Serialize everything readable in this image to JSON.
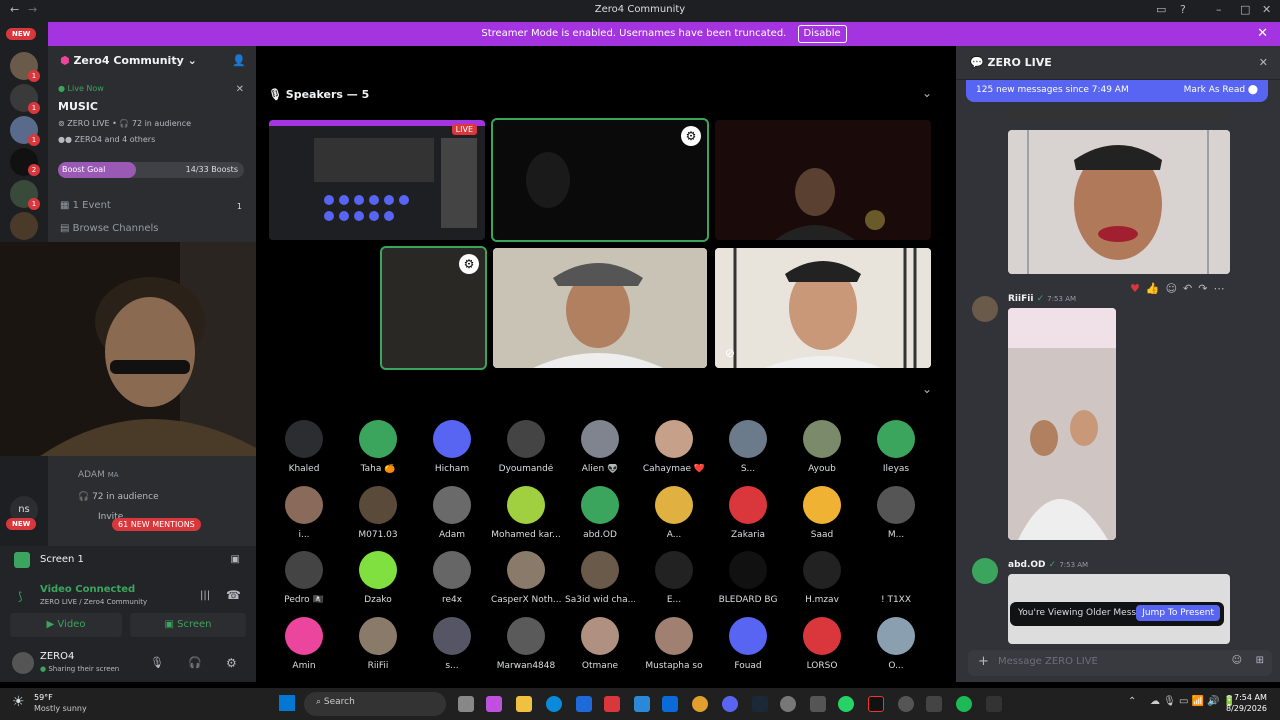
{
  "window": {
    "title": "Zero4 Community"
  },
  "banner": {
    "text": "Streamer Mode is enabled. Usernames have been truncated.",
    "disable": "Disable"
  },
  "rail": {
    "new_top": "NEW",
    "new_bottom": "NEW",
    "badges": [
      "1",
      "1",
      "1",
      "1",
      "2",
      "1",
      "1"
    ],
    "ns": "ns"
  },
  "sidebar": {
    "server_name": "Zero4 Community",
    "live_now": "Live Now",
    "channel": "MUSIC",
    "stage_info": "ZERO LIVE",
    "audience": "72 in audience",
    "participants": "ZERO4 and 4 others",
    "boost_label": "Boost Goal",
    "boost_count": "14/33 Boosts",
    "event": "1 Event",
    "event_count": "1",
    "browse": "Browse Channels",
    "member_adam": "ADAM",
    "adam_tag": "MA",
    "audience2": "72 in audience",
    "invite": "Invite...",
    "mentions": "61 NEW MENTIONS"
  },
  "voice": {
    "screen_label": "Screen 1",
    "status": "Video Connected",
    "location": "ZERO LIVE / Zero4 Community",
    "video_btn": "Video",
    "screen_btn": "Screen",
    "user": "ZERO4",
    "user_status": "Sharing their screen"
  },
  "stage": {
    "speakers": "Speakers — 5",
    "live_badge": "LIVE",
    "members": [
      {
        "name": "Khaled",
        "color": "#2b2d31"
      },
      {
        "name": "Taha 🍊",
        "color": "#3ba55d"
      },
      {
        "name": "Hicham",
        "color": "#5865f2"
      },
      {
        "name": "Dyoumandé",
        "color": "#444"
      },
      {
        "name": "Alien 👽",
        "color": "#80848e"
      },
      {
        "name": "Cahaymae ❤️",
        "color": "#c7a08a"
      },
      {
        "name": "S...",
        "color": "#6b7b8c"
      },
      {
        "name": "Ayoub",
        "color": "#7a8a6a"
      },
      {
        "name": "Ileyas",
        "color": "#3ba55d"
      },
      {
        "name": "i...",
        "color": "#8a6a5a"
      },
      {
        "name": "M071.03",
        "color": "#5a4a3a"
      },
      {
        "name": "Adam",
        "color": "#6a6a6a"
      },
      {
        "name": "Mohamed kar...",
        "color": "#a0d040"
      },
      {
        "name": "abd.OD",
        "color": "#3ba55d"
      },
      {
        "name": "A...",
        "color": "#e0b040"
      },
      {
        "name": "Zakaria",
        "color": "#da373c"
      },
      {
        "name": "Saad",
        "color": "#f0b232"
      },
      {
        "name": "M...",
        "color": "#555"
      },
      {
        "name": "Pedro 🏴‍☠️",
        "color": "#444"
      },
      {
        "name": "Dzako",
        "color": "#80e040"
      },
      {
        "name": "re4x",
        "color": "#666"
      },
      {
        "name": "CasperX Noth...",
        "color": "#8a7a6a"
      },
      {
        "name": "Sa3id wid cha...",
        "color": "#6a5a4a"
      },
      {
        "name": "E...",
        "color": "#222"
      },
      {
        "name": "BLEDARD BG",
        "color": "#111"
      },
      {
        "name": "H.mzav",
        "color": "#222"
      },
      {
        "name": "! T1XX",
        "color": "#000"
      },
      {
        "name": "Amin",
        "color": "#eb459e"
      },
      {
        "name": "RiiFii",
        "color": "#8a7a6a"
      },
      {
        "name": "s...",
        "color": "#556"
      },
      {
        "name": "Marwan4848",
        "color": "#5a5a5a"
      },
      {
        "name": "Otmane",
        "color": "#b09080"
      },
      {
        "name": "Mustapha so",
        "color": "#a08070"
      },
      {
        "name": "Fouad",
        "color": "#5865f2"
      },
      {
        "name": "LORSO",
        "color": "#da373c"
      },
      {
        "name": "O...",
        "color": "#8aa0b0"
      }
    ]
  },
  "chat": {
    "title": "ZERO LIVE",
    "new_messages": "125 new messages since 7:49 AM",
    "mark_read": "Mark As Read",
    "msg1_user": "RiiFii",
    "msg1_time": "7:53 AM",
    "msg2_user": "abd.OD",
    "msg2_time": "7:53 AM",
    "older": "You're Viewing Older Messages",
    "jump": "Jump To Present",
    "placeholder": "Message ZERO LIVE"
  },
  "taskbar": {
    "weather_temp": "59°F",
    "weather_desc": "Mostly sunny",
    "search": "Search",
    "time": "7:54 AM",
    "date": "8/29/2026"
  }
}
